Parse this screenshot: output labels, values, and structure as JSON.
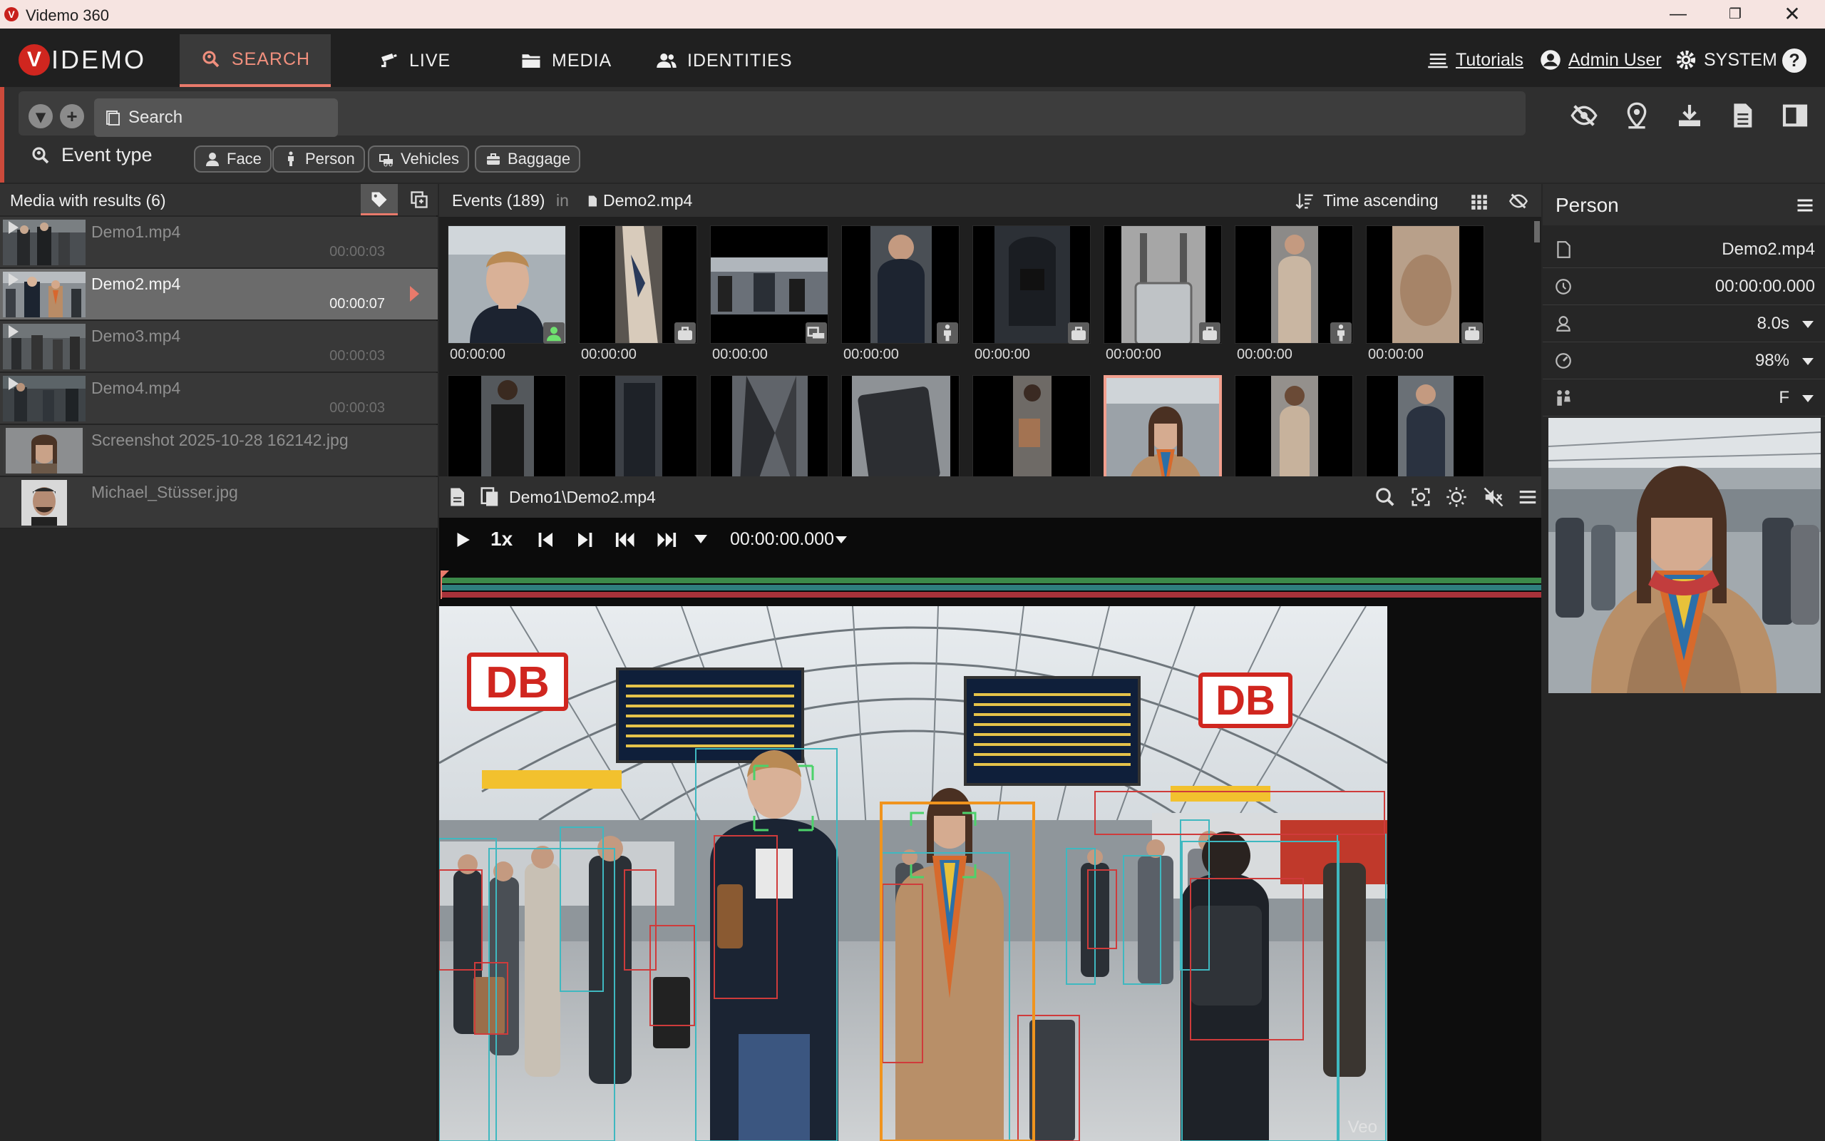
{
  "window": {
    "title": "Videmo 360",
    "app_icon_letter": "V"
  },
  "brand": {
    "logo_first": "V",
    "logo_rest": "IDEMO",
    "accent": "#e87a6b",
    "brand_red": "#d0261f"
  },
  "nav": {
    "tabs": [
      {
        "label": "SEARCH",
        "icon": "search-icon",
        "active": true
      },
      {
        "label": "LIVE",
        "icon": "camera-icon",
        "active": false
      },
      {
        "label": "MEDIA",
        "icon": "folder-icon",
        "active": false
      },
      {
        "label": "IDENTITIES",
        "icon": "people-icon",
        "active": false
      }
    ],
    "tutorials": "Tutorials",
    "user": "Admin User",
    "system": "SYSTEM",
    "help": "?"
  },
  "search": {
    "placeholder": "Search",
    "event_type_label": "Event type",
    "filters": [
      "Face",
      "Person",
      "Vehicles",
      "Baggage"
    ],
    "toolbar_icons": [
      "hide-icon",
      "location-icon",
      "download-icon",
      "document-icon",
      "panel-toggle-icon"
    ]
  },
  "media_panel": {
    "title": "Media with results (6)",
    "items": [
      {
        "name": "Demo1.mp4",
        "duration": "00:00:03",
        "selected": false,
        "video": true
      },
      {
        "name": "Demo2.mp4",
        "duration": "00:00:07",
        "selected": true,
        "video": true
      },
      {
        "name": "Demo3.mp4",
        "duration": "00:00:03",
        "selected": false,
        "video": true
      },
      {
        "name": "Demo4.mp4",
        "duration": "00:00:03",
        "selected": false,
        "video": true
      },
      {
        "name": "Screenshot 2025-10-28 162142.jpg",
        "duration": "",
        "selected": false,
        "video": false
      },
      {
        "name": "Michael_Stüsser.jpg",
        "duration": "",
        "selected": false,
        "video": false
      }
    ]
  },
  "events": {
    "title": "Events (189)",
    "in_label": "in",
    "file": "Demo2.mp4",
    "sort": "Time ascending",
    "row1": [
      {
        "time": "00:00:00",
        "type": "face"
      },
      {
        "time": "00:00:00",
        "type": "baggage"
      },
      {
        "time": "00:00:00",
        "type": "vehicle"
      },
      {
        "time": "00:00:00",
        "type": "person"
      },
      {
        "time": "00:00:00",
        "type": "baggage"
      },
      {
        "time": "00:00:00",
        "type": "baggage"
      },
      {
        "time": "00:00:00",
        "type": "person"
      },
      {
        "time": "00:00:00",
        "type": "baggage"
      }
    ],
    "row2_count": 8,
    "selected_row2_index": 5
  },
  "player": {
    "path": "Demo1\\Demo2.mp4",
    "speed": "1x",
    "timecode": "00:00:00.000",
    "watermark": "Veo"
  },
  "detail": {
    "title": "Person",
    "file": "Demo2.mp4",
    "time": "00:00:00.000",
    "duration": "8.0s",
    "confidence": "98%",
    "gender": "F"
  }
}
